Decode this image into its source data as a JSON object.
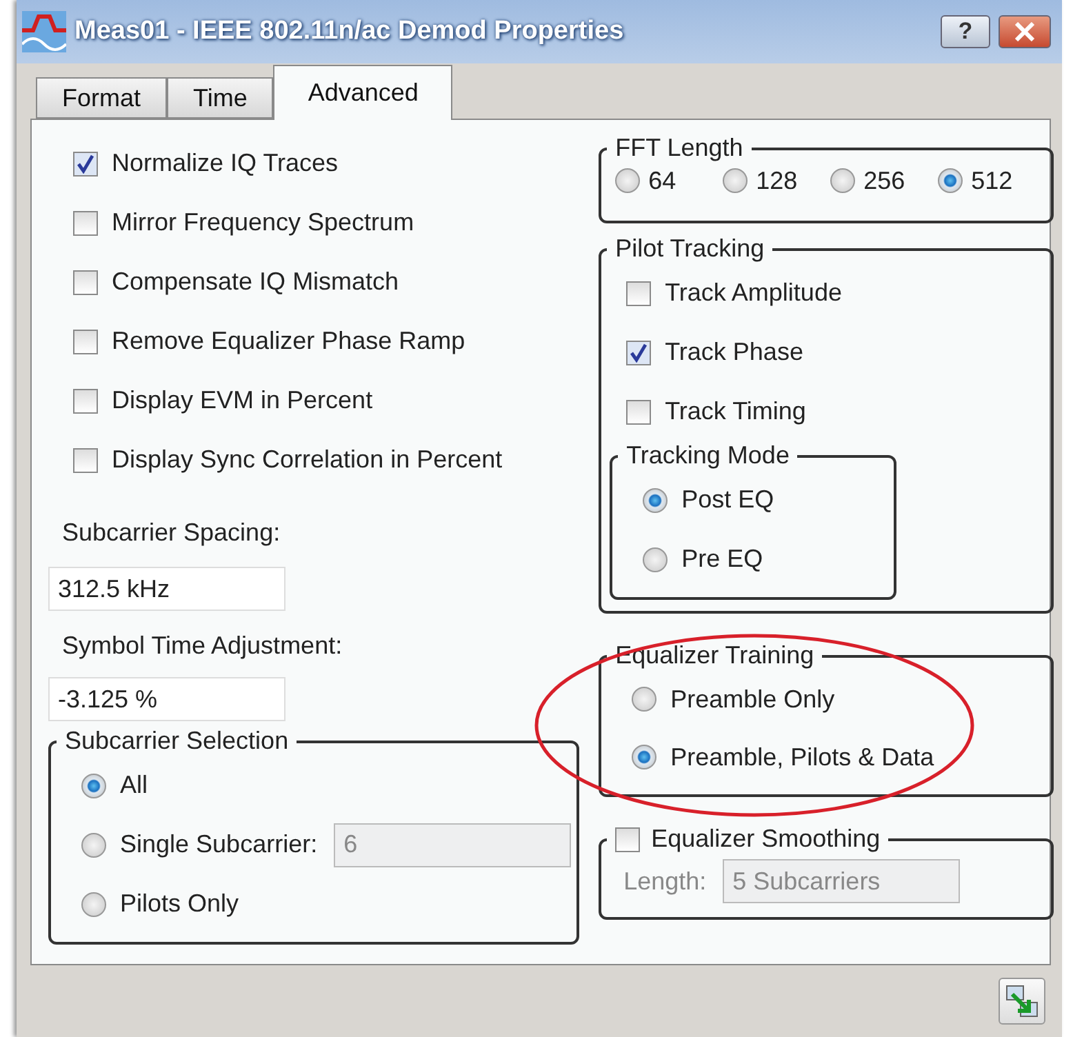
{
  "window": {
    "title": "Meas01 - IEEE 802.11n/ac Demod Properties",
    "help_button": "?"
  },
  "tabs": [
    {
      "label": "Format",
      "selected": false
    },
    {
      "label": "Time",
      "selected": false
    },
    {
      "label": "Advanced",
      "selected": true
    }
  ],
  "options": [
    {
      "label": "Normalize IQ Traces",
      "checked": true
    },
    {
      "label": "Mirror Frequency Spectrum",
      "checked": false
    },
    {
      "label": "Compensate IQ Mismatch",
      "checked": false
    },
    {
      "label": "Remove Equalizer Phase Ramp",
      "checked": false
    },
    {
      "label": "Display EVM in Percent",
      "checked": false
    },
    {
      "label": "Display Sync Correlation in Percent",
      "checked": false
    }
  ],
  "subcarrier_spacing": {
    "label": "Subcarrier Spacing:",
    "value": "312.5 kHz"
  },
  "symbol_time_adjustment": {
    "label": "Symbol Time Adjustment:",
    "value": "-3.125 %"
  },
  "subcarrier_selection": {
    "title": "Subcarrier Selection",
    "options": [
      {
        "label": "All",
        "selected": true
      },
      {
        "label": "Single Subcarrier:",
        "selected": false,
        "value": "6",
        "disabled": true
      },
      {
        "label": "Pilots Only",
        "selected": false
      }
    ]
  },
  "fft_length": {
    "title": "FFT Length",
    "options": [
      {
        "label": "64",
        "selected": false
      },
      {
        "label": "128",
        "selected": false
      },
      {
        "label": "256",
        "selected": false
      },
      {
        "label": "512",
        "selected": true
      }
    ]
  },
  "pilot_tracking": {
    "title": "Pilot Tracking",
    "options": [
      {
        "label": "Track Amplitude",
        "checked": false
      },
      {
        "label": "Track Phase",
        "checked": true
      },
      {
        "label": "Track Timing",
        "checked": false
      }
    ],
    "tracking_mode": {
      "title": "Tracking Mode",
      "options": [
        {
          "label": "Post EQ",
          "selected": true
        },
        {
          "label": "Pre EQ",
          "selected": false
        }
      ]
    }
  },
  "equalizer_training": {
    "title": "Equalizer Training",
    "options": [
      {
        "label": "Preamble Only",
        "selected": false
      },
      {
        "label": "Preamble, Pilots & Data",
        "selected": true
      }
    ]
  },
  "equalizer_smoothing": {
    "title": "Equalizer Smoothing",
    "checked": false,
    "length_label": "Length:",
    "length_value": "5 Subcarriers",
    "disabled": true
  }
}
